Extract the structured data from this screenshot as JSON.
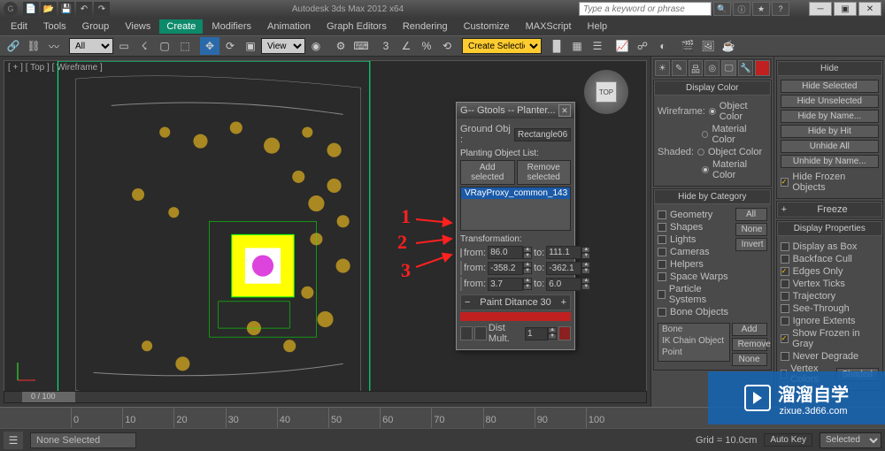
{
  "titlebar": {
    "app_title": "Autodesk 3ds Max 2012 x64",
    "search_placeholder": "Type a keyword or phrase"
  },
  "menus": [
    "Edit",
    "Tools",
    "Group",
    "Views",
    "Create",
    "Modifiers",
    "Animation",
    "Graph Editors",
    "Rendering",
    "Customize",
    "MAXScript",
    "Help"
  ],
  "menu_highlight_index": 4,
  "toolbar": {
    "selection_filter": "All",
    "ref_coord": "View",
    "named_selection": "Create Selection Set"
  },
  "viewport": {
    "label": "[ + ] [ Top ] [ Wireframe ]",
    "viewcube_face": "TOP",
    "scroll_label": "0 / 100"
  },
  "dialog": {
    "title": "-- Gtools -- Planter...",
    "ground_label": "Ground Obj :",
    "ground_value": "Rectangle06",
    "planting_label": "Planting Object List:",
    "btn_add": "Add selected",
    "btn_remove": "Remove selected",
    "list_item": "VRayProxy_common_143",
    "transformation_label": "Transformation:",
    "tf_rows": [
      {
        "from": "86.0",
        "to": "111.1"
      },
      {
        "from": "-358.2",
        "to": "-362.1"
      },
      {
        "from": "3.7",
        "to": "6.0"
      }
    ],
    "from_label": "from:",
    "to_label": "to:",
    "paint_dist_label": "Paint Ditance",
    "paint_dist_value": "30",
    "dist_mult_label": "Dist Mult.",
    "dist_mult_value": "1"
  },
  "annotations": [
    "1",
    "2",
    "3"
  ],
  "display_color": {
    "rollout_title": "Display Color",
    "wireframe_label": "Wireframe:",
    "shaded_label": "Shaded:",
    "opt_object": "Object Color",
    "opt_material": "Material Color"
  },
  "hide_category": {
    "rollout_title": "Hide by Category",
    "items": [
      "Geometry",
      "Shapes",
      "Lights",
      "Cameras",
      "Helpers",
      "Space Warps",
      "Particle Systems",
      "Bone Objects"
    ],
    "btn_all": "All",
    "btn_none": "None",
    "btn_invert": "Invert",
    "list1": "Bone",
    "list2": "IK Chain Object",
    "list3": "Point",
    "btn_add": "Add",
    "btn_remove": "Remove",
    "btn_none2": "None"
  },
  "hide_rollout": {
    "title": "Hide",
    "btns": [
      "Hide Selected",
      "Hide Unselected",
      "Hide by Name...",
      "Hide by Hit",
      "Unhide All",
      "Unhide by Name..."
    ],
    "chk_frozen": "Hide Frozen Objects"
  },
  "freeze_rollout": {
    "title": "Freeze"
  },
  "display_props": {
    "title": "Display Properties",
    "items": [
      {
        "label": "Display as Box",
        "checked": false
      },
      {
        "label": "Backface Cull",
        "checked": false
      },
      {
        "label": "Edges Only",
        "checked": true
      },
      {
        "label": "Vertex Ticks",
        "checked": false
      },
      {
        "label": "Trajectory",
        "checked": false
      },
      {
        "label": "See-Through",
        "checked": false
      },
      {
        "label": "Ignore Extents",
        "checked": false
      },
      {
        "label": "Show Frozen in Gray",
        "checked": true
      },
      {
        "label": "Never Degrade",
        "checked": false
      }
    ],
    "vertex_colors": "Vertex Colors",
    "shaded_btn": "Shaded"
  },
  "statusbar": {
    "none_selected": "None Selected",
    "grid": "Grid = 10.0cm",
    "auto_key": "Auto Key",
    "selected": "Selected"
  },
  "timeline_ticks": [
    "0",
    "10",
    "20",
    "30",
    "40",
    "50",
    "60",
    "70",
    "80",
    "90",
    "100"
  ],
  "watermark": {
    "line1": "溜溜自学",
    "line2": "zixue.3d66.com"
  }
}
